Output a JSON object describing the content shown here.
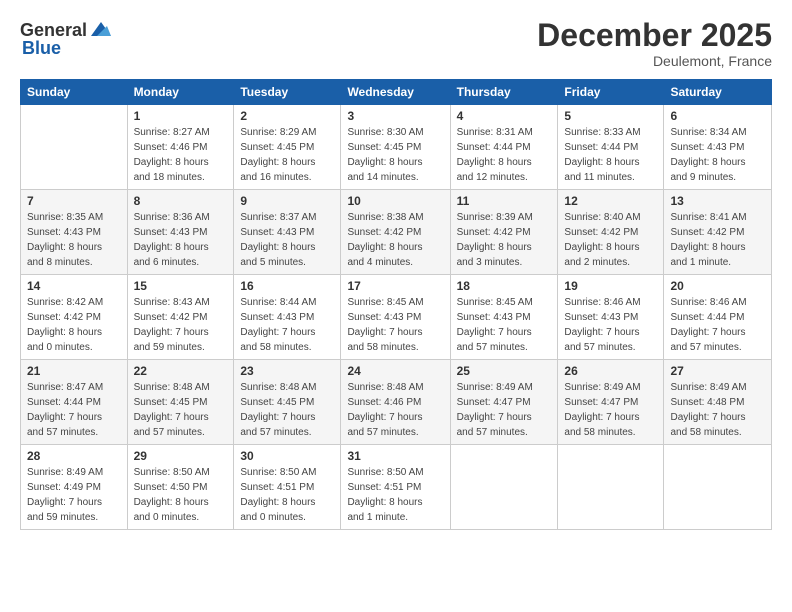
{
  "header": {
    "logo_general": "General",
    "logo_blue": "Blue",
    "month_title": "December 2025",
    "location": "Deulemont, France"
  },
  "days_of_week": [
    "Sunday",
    "Monday",
    "Tuesday",
    "Wednesday",
    "Thursday",
    "Friday",
    "Saturday"
  ],
  "weeks": [
    [
      {
        "day": "",
        "info": ""
      },
      {
        "day": "1",
        "info": "Sunrise: 8:27 AM\nSunset: 4:46 PM\nDaylight: 8 hours\nand 18 minutes."
      },
      {
        "day": "2",
        "info": "Sunrise: 8:29 AM\nSunset: 4:45 PM\nDaylight: 8 hours\nand 16 minutes."
      },
      {
        "day": "3",
        "info": "Sunrise: 8:30 AM\nSunset: 4:45 PM\nDaylight: 8 hours\nand 14 minutes."
      },
      {
        "day": "4",
        "info": "Sunrise: 8:31 AM\nSunset: 4:44 PM\nDaylight: 8 hours\nand 12 minutes."
      },
      {
        "day": "5",
        "info": "Sunrise: 8:33 AM\nSunset: 4:44 PM\nDaylight: 8 hours\nand 11 minutes."
      },
      {
        "day": "6",
        "info": "Sunrise: 8:34 AM\nSunset: 4:43 PM\nDaylight: 8 hours\nand 9 minutes."
      }
    ],
    [
      {
        "day": "7",
        "info": "Sunrise: 8:35 AM\nSunset: 4:43 PM\nDaylight: 8 hours\nand 8 minutes."
      },
      {
        "day": "8",
        "info": "Sunrise: 8:36 AM\nSunset: 4:43 PM\nDaylight: 8 hours\nand 6 minutes."
      },
      {
        "day": "9",
        "info": "Sunrise: 8:37 AM\nSunset: 4:43 PM\nDaylight: 8 hours\nand 5 minutes."
      },
      {
        "day": "10",
        "info": "Sunrise: 8:38 AM\nSunset: 4:42 PM\nDaylight: 8 hours\nand 4 minutes."
      },
      {
        "day": "11",
        "info": "Sunrise: 8:39 AM\nSunset: 4:42 PM\nDaylight: 8 hours\nand 3 minutes."
      },
      {
        "day": "12",
        "info": "Sunrise: 8:40 AM\nSunset: 4:42 PM\nDaylight: 8 hours\nand 2 minutes."
      },
      {
        "day": "13",
        "info": "Sunrise: 8:41 AM\nSunset: 4:42 PM\nDaylight: 8 hours\nand 1 minute."
      }
    ],
    [
      {
        "day": "14",
        "info": "Sunrise: 8:42 AM\nSunset: 4:42 PM\nDaylight: 8 hours\nand 0 minutes."
      },
      {
        "day": "15",
        "info": "Sunrise: 8:43 AM\nSunset: 4:42 PM\nDaylight: 7 hours\nand 59 minutes."
      },
      {
        "day": "16",
        "info": "Sunrise: 8:44 AM\nSunset: 4:43 PM\nDaylight: 7 hours\nand 58 minutes."
      },
      {
        "day": "17",
        "info": "Sunrise: 8:45 AM\nSunset: 4:43 PM\nDaylight: 7 hours\nand 58 minutes."
      },
      {
        "day": "18",
        "info": "Sunrise: 8:45 AM\nSunset: 4:43 PM\nDaylight: 7 hours\nand 57 minutes."
      },
      {
        "day": "19",
        "info": "Sunrise: 8:46 AM\nSunset: 4:43 PM\nDaylight: 7 hours\nand 57 minutes."
      },
      {
        "day": "20",
        "info": "Sunrise: 8:46 AM\nSunset: 4:44 PM\nDaylight: 7 hours\nand 57 minutes."
      }
    ],
    [
      {
        "day": "21",
        "info": "Sunrise: 8:47 AM\nSunset: 4:44 PM\nDaylight: 7 hours\nand 57 minutes."
      },
      {
        "day": "22",
        "info": "Sunrise: 8:48 AM\nSunset: 4:45 PM\nDaylight: 7 hours\nand 57 minutes."
      },
      {
        "day": "23",
        "info": "Sunrise: 8:48 AM\nSunset: 4:45 PM\nDaylight: 7 hours\nand 57 minutes."
      },
      {
        "day": "24",
        "info": "Sunrise: 8:48 AM\nSunset: 4:46 PM\nDaylight: 7 hours\nand 57 minutes."
      },
      {
        "day": "25",
        "info": "Sunrise: 8:49 AM\nSunset: 4:47 PM\nDaylight: 7 hours\nand 57 minutes."
      },
      {
        "day": "26",
        "info": "Sunrise: 8:49 AM\nSunset: 4:47 PM\nDaylight: 7 hours\nand 58 minutes."
      },
      {
        "day": "27",
        "info": "Sunrise: 8:49 AM\nSunset: 4:48 PM\nDaylight: 7 hours\nand 58 minutes."
      }
    ],
    [
      {
        "day": "28",
        "info": "Sunrise: 8:49 AM\nSunset: 4:49 PM\nDaylight: 7 hours\nand 59 minutes."
      },
      {
        "day": "29",
        "info": "Sunrise: 8:50 AM\nSunset: 4:50 PM\nDaylight: 8 hours\nand 0 minutes."
      },
      {
        "day": "30",
        "info": "Sunrise: 8:50 AM\nSunset: 4:51 PM\nDaylight: 8 hours\nand 0 minutes."
      },
      {
        "day": "31",
        "info": "Sunrise: 8:50 AM\nSunset: 4:51 PM\nDaylight: 8 hours\nand 1 minute."
      },
      {
        "day": "",
        "info": ""
      },
      {
        "day": "",
        "info": ""
      },
      {
        "day": "",
        "info": ""
      }
    ]
  ]
}
